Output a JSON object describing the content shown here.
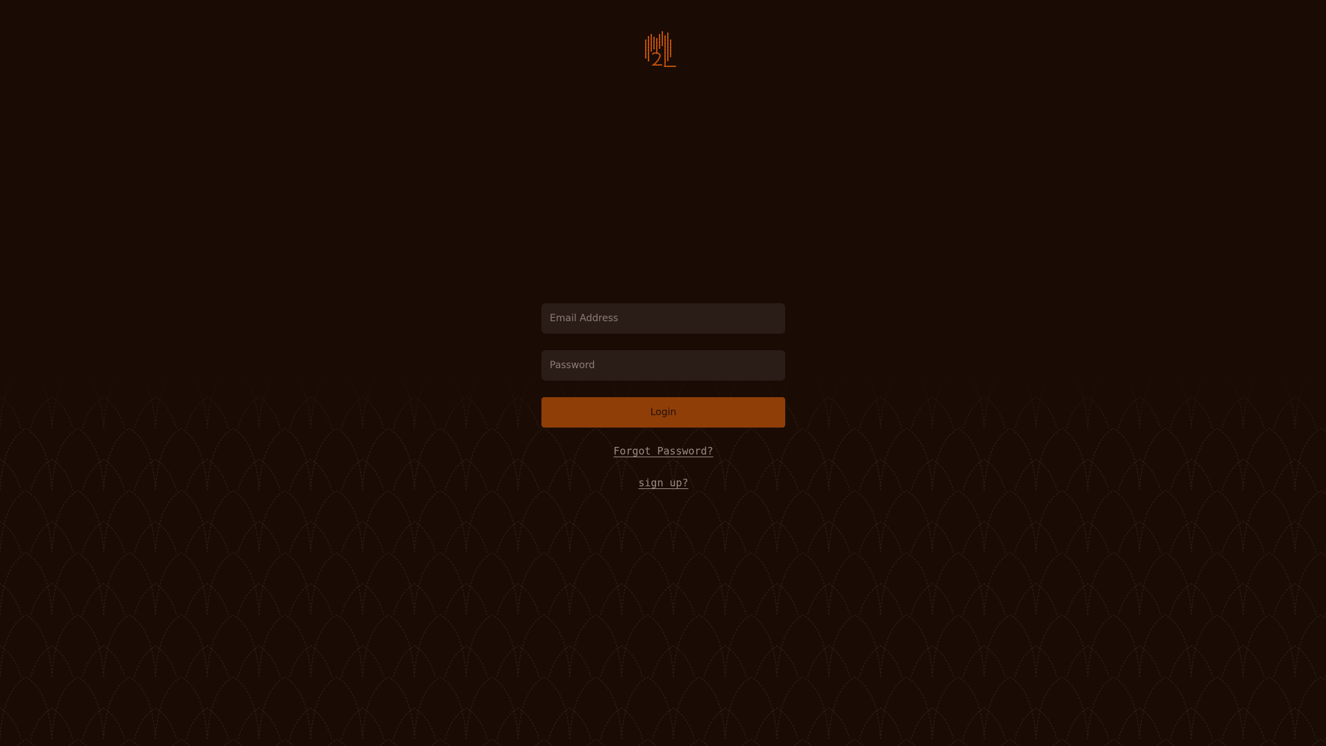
{
  "app": {
    "logo_icon": "brand-mark-icon",
    "accent_color": "#c2520c",
    "background_color": "#1a0c05"
  },
  "login_form": {
    "email_placeholder": "Email Address",
    "password_placeholder": "Password",
    "login_label": "Login",
    "forgot_password_label": "Forgot Password?",
    "sign_up_label": "sign up?"
  }
}
